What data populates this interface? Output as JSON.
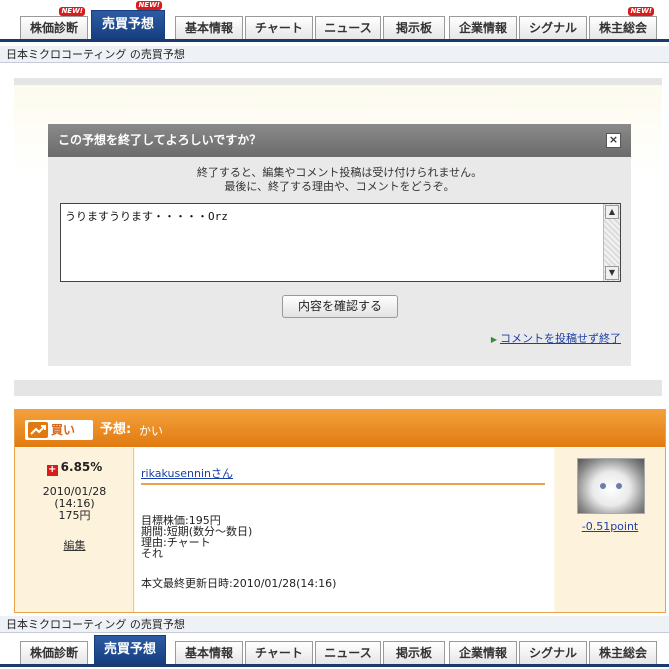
{
  "tabs_top": [
    {
      "label": "株価診断",
      "badge": "NEW!"
    },
    {
      "label": "売買予想",
      "badge": "NEW!",
      "active": true
    },
    {
      "label": "基本情報"
    },
    {
      "label": "チャート"
    },
    {
      "label": "ニュース"
    },
    {
      "label": "掲示板"
    },
    {
      "label": "企業情報"
    },
    {
      "label": "シグナル"
    },
    {
      "label": "株主総会",
      "badge": "NEW!"
    }
  ],
  "tabs_bottom": [
    {
      "label": "株価診断"
    },
    {
      "label": "売買予想",
      "active": true
    },
    {
      "label": "基本情報"
    },
    {
      "label": "チャート"
    },
    {
      "label": "ニュース"
    },
    {
      "label": "掲示板"
    },
    {
      "label": "企業情報"
    },
    {
      "label": "シグナル"
    },
    {
      "label": "株主総会"
    }
  ],
  "breadcrumb_top": "日本ミクロコーティング の売買予想",
  "breadcrumb_bottom": "日本ミクロコーティング の売買予想",
  "dialog": {
    "title": "この予想を終了してよろしいですか？",
    "close_symbol": "×",
    "message_line1": "終了すると、編集やコメント投稿は受け付けられません。",
    "message_line2": "最後に、終了する理由や、コメントをどうぞ。",
    "comment_value": "うりますうります・・・・・Orz",
    "confirm_label": "内容を確認する",
    "end_link_label": "コメントを投稿せず終了"
  },
  "prediction": {
    "badge_label": "買い",
    "label": "予想:",
    "value": "かい",
    "percent": "6.85%",
    "date": "2010/01/28",
    "time": "(14:16)",
    "price": "175円",
    "edit_label": "編集",
    "user": "rikakusenninさん",
    "target_price": "目標株価:195円",
    "period": "期間:短期(数分～数日)",
    "reason_label": "理由:チャート",
    "reason_text": "それ",
    "updated": "本文最終更新日時:2010/01/28(14:16)",
    "points": "-0.51point"
  },
  "colors": {
    "tab_active": "#1a3a6e",
    "header_orange": "#e07a10",
    "link_blue": "#1a3ea8",
    "plus_red": "#d81b1b"
  }
}
